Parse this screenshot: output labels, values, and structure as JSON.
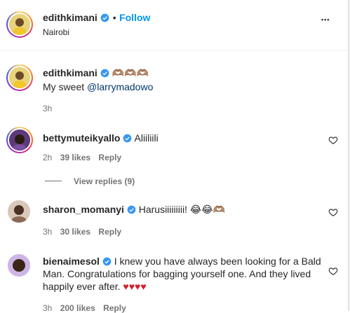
{
  "post": {
    "author": "edithkimani",
    "follow_label": "Follow",
    "dot": "•",
    "location": "Nairobi",
    "more": "•••"
  },
  "caption": {
    "author": "edithkimani",
    "emojis": "🫶🏽🫶🏽🫶🏽",
    "text_prefix": "My sweet ",
    "mention": "@larrymadowo",
    "time": "3h"
  },
  "comments": [
    {
      "user": "bettymuteikyallo",
      "text": "Aliiliili",
      "time": "2h",
      "likes": "39 likes",
      "reply": "Reply",
      "view_replies": "View replies (9)"
    },
    {
      "user": "sharon_momanyi",
      "text": "Harusiiiiiiiii! 😂😂🫶🏽",
      "time": "3h",
      "likes": "30 likes",
      "reply": "Reply"
    },
    {
      "user": "bienaimesol",
      "text": "I knew you have always been looking for a Bald Man. Congratulations for bagging yourself one. And they lived happily ever after.",
      "hearts": "♥♥♥♥",
      "time": "3h",
      "likes": "200 likes",
      "reply": "Reply"
    }
  ],
  "colors": {
    "link": "#0095f6",
    "mention": "#00376b",
    "heart_red": "#d61e2b",
    "verified": "#3897f0"
  }
}
